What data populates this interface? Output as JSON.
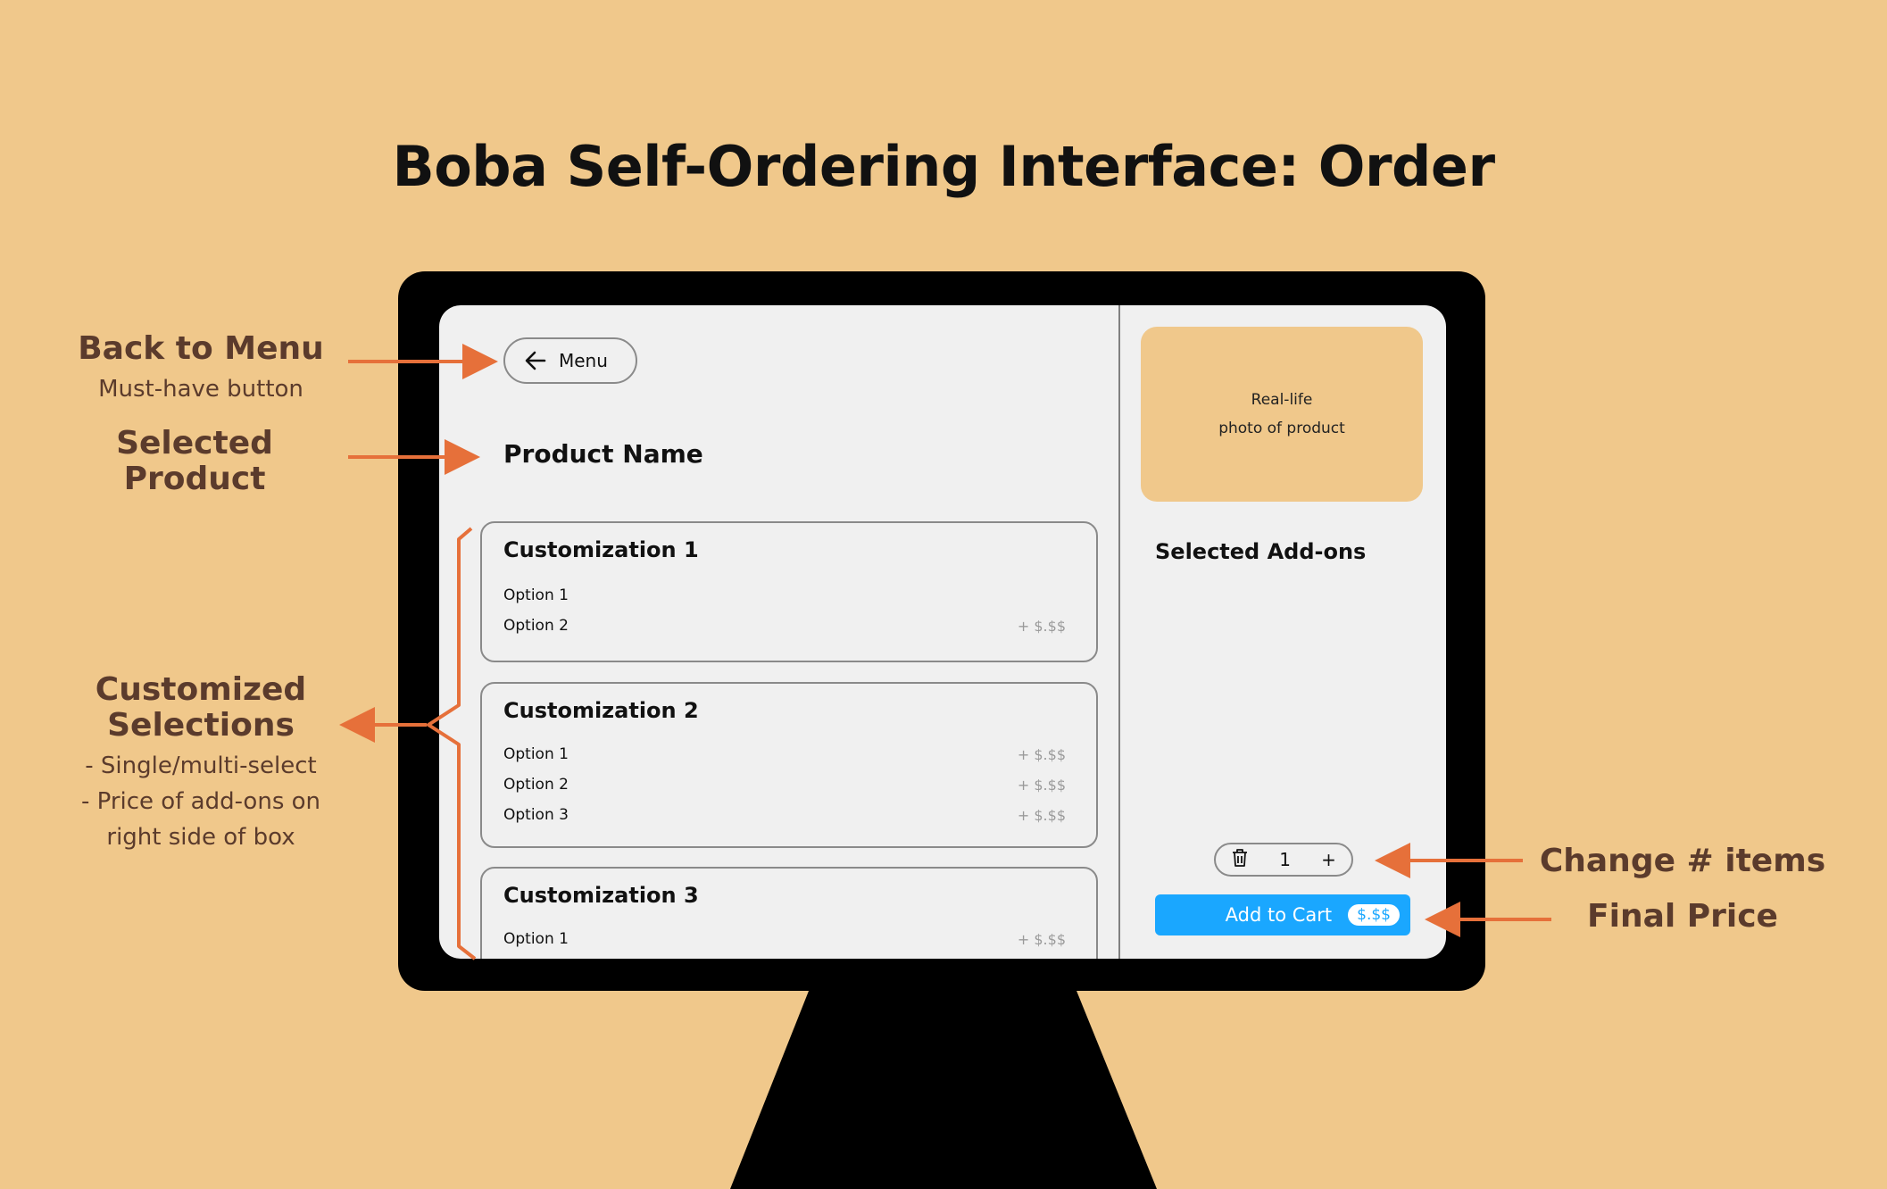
{
  "title": "Boba Self-Ordering Interface: Order",
  "annotations": {
    "back_to_menu": {
      "title": "Back to Menu",
      "sub": "Must-have button"
    },
    "selected_product": {
      "title_line1": "Selected",
      "title_line2": "Product"
    },
    "customized": {
      "title_line1": "Customized",
      "title_line2": "Selections",
      "line1": "- Single/multi-select",
      "line2": "- Price of add-ons on",
      "line3": "right side of box"
    },
    "change_items": {
      "title": "Change # items"
    },
    "final_price": {
      "title": "Final Price"
    }
  },
  "screen": {
    "menu_button": "Menu",
    "product_name": "Product Name",
    "customizations": [
      {
        "title": "Customization 1",
        "options": [
          {
            "label": "Option 1",
            "price": ""
          },
          {
            "label": "Option 2",
            "price": "+ $.$$"
          }
        ]
      },
      {
        "title": "Customization 2",
        "options": [
          {
            "label": "Option 1",
            "price": "+ $.$$"
          },
          {
            "label": "Option 2",
            "price": "+ $.$$"
          },
          {
            "label": "Option 3",
            "price": "+ $.$$"
          }
        ]
      },
      {
        "title": "Customization 3",
        "options": [
          {
            "label": "Option 1",
            "price": "+ $.$$"
          }
        ]
      }
    ],
    "photo_line1": "Real-life",
    "photo_line2": "photo of product",
    "selected_addons_title": "Selected Add-ons",
    "quantity": "1",
    "plus": "+",
    "add_to_cart": "Add to Cart",
    "cart_price": "$.$$"
  },
  "colors": {
    "background": "#f0c88b",
    "accent_arrow": "#e6703a",
    "annotation_text": "#5b3b2c",
    "cart_button": "#1aa7ff"
  }
}
